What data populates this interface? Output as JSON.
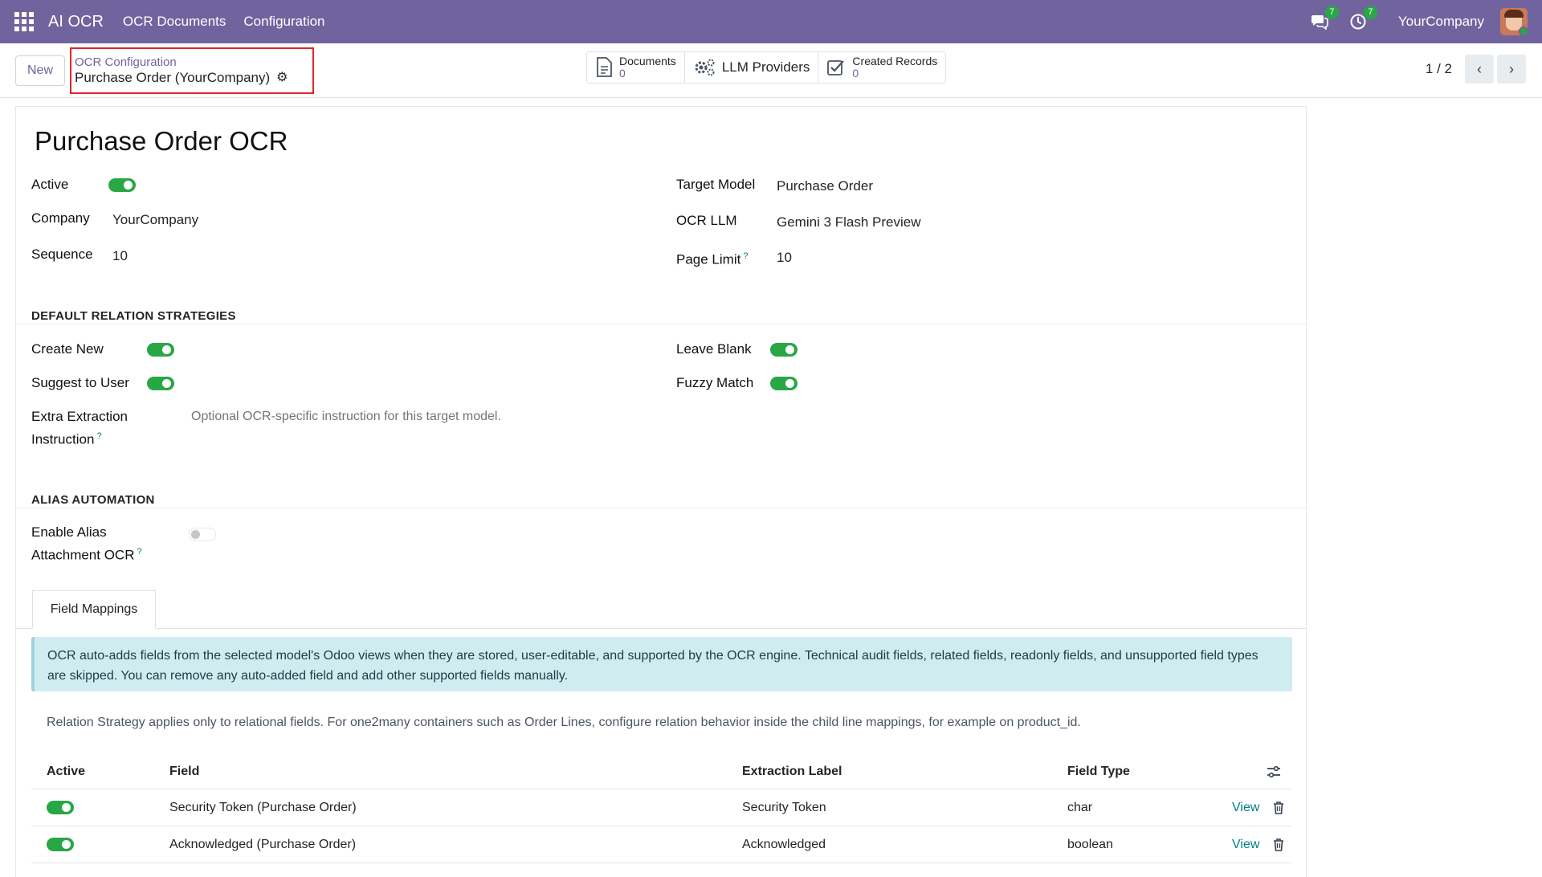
{
  "navbar": {
    "brand": "AI OCR",
    "menus": [
      "OCR Documents",
      "Configuration"
    ],
    "messages_count": "7",
    "activities_count": "7",
    "company": "YourCompany"
  },
  "control": {
    "new_label": "New",
    "breadcrumb_parent": "OCR Configuration",
    "breadcrumb_current": "Purchase Order (YourCompany)",
    "smart_buttons": {
      "documents_label": "Documents",
      "documents_count": "0",
      "llm_label": "LLM Providers",
      "records_label": "Created Records",
      "records_count": "0"
    },
    "pager": "1 / 2"
  },
  "form": {
    "title": "Purchase Order OCR",
    "active_label": "Active",
    "active": true,
    "company_label": "Company",
    "company_value": "YourCompany",
    "sequence_label": "Sequence",
    "sequence_value": "10",
    "target_model_label": "Target Model",
    "target_model_value": "Purchase Order",
    "ocr_llm_label": "OCR LLM",
    "ocr_llm_value": "Gemini 3 Flash Preview",
    "page_limit_label": "Page Limit",
    "page_limit_value": "10",
    "help_mark": "?"
  },
  "relation": {
    "section_title": "DEFAULT RELATION STRATEGIES",
    "create_new_label": "Create New",
    "suggest_label": "Suggest to User",
    "leave_blank_label": "Leave Blank",
    "fuzzy_label": "Fuzzy Match",
    "extra_label_line1": "Extra Extraction",
    "extra_label_line2": "Instruction",
    "extra_placeholder": "Optional OCR-specific instruction for this target model."
  },
  "alias": {
    "section_title": "ALIAS AUTOMATION",
    "enable_label_line1": "Enable Alias",
    "enable_label_line2": "Attachment OCR",
    "enabled": false
  },
  "tabs": {
    "field_mappings": "Field Mappings"
  },
  "alert_text": "OCR auto-adds fields from the selected model's Odoo views when they are stored, user-editable, and supported by the OCR engine. Technical audit fields, related fields, readonly fields, and unsupported field types are skipped. You can remove any auto-added field and add other supported fields manually.",
  "note_text": "Relation Strategy applies only to relational fields. For one2many containers such as Order Lines, configure relation behavior inside the child line mappings, for example on product_id.",
  "table": {
    "headers": {
      "active": "Active",
      "field": "Field",
      "label": "Extraction Label",
      "type": "Field Type"
    },
    "rows": [
      {
        "active": true,
        "field": "Security Token (Purchase Order)",
        "label": "Security Token",
        "type": "char",
        "view": "View"
      },
      {
        "active": true,
        "field": "Acknowledged (Purchase Order)",
        "label": "Acknowledged",
        "type": "boolean",
        "view": "View"
      }
    ]
  },
  "colors": {
    "navbar": "#71639e",
    "toggle_on": "#28a745",
    "link": "#017e84",
    "alert_bg": "#d1ecf1",
    "highlight_border": "#e0242b"
  }
}
